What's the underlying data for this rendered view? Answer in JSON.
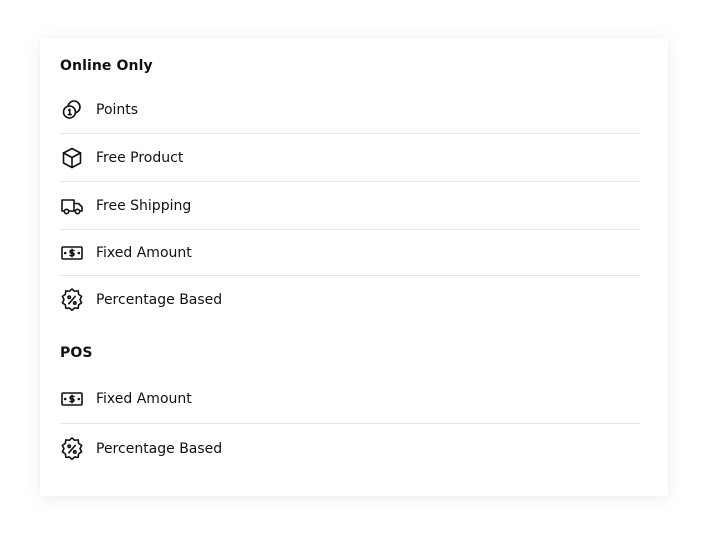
{
  "sections": [
    {
      "title": "Online Only",
      "items": [
        {
          "label": "Points",
          "icon": "coins-icon"
        },
        {
          "label": "Free Product",
          "icon": "box-icon"
        },
        {
          "label": "Free Shipping",
          "icon": "truck-icon"
        },
        {
          "label": "Fixed Amount",
          "icon": "dollar-bill-icon"
        },
        {
          "label": "Percentage Based",
          "icon": "percent-badge-icon"
        }
      ]
    },
    {
      "title": "POS",
      "items": [
        {
          "label": "Fixed Amount",
          "icon": "dollar-bill-icon"
        },
        {
          "label": "Percentage Based",
          "icon": "percent-badge-icon"
        }
      ]
    }
  ]
}
